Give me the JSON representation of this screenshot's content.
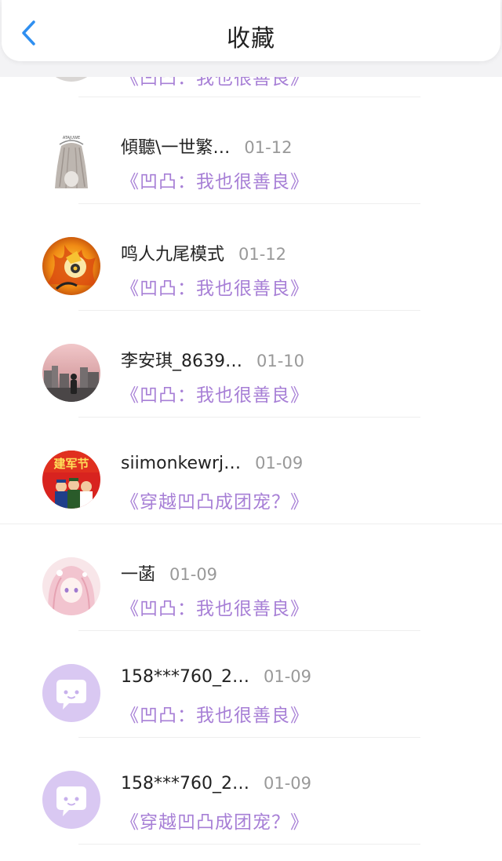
{
  "header": {
    "title": "收藏"
  },
  "partial_item": {
    "book": "《凹凸：我也很善良》"
  },
  "items": [
    {
      "name": "傾聽\\一世繁…",
      "date": "01-12",
      "book": "《凹凸：我也很善良》",
      "avatar": "portrait-sketch"
    },
    {
      "name": "鸣人九尾模式",
      "date": "01-12",
      "book": "《凹凸：我也很善良》",
      "avatar": "naruto-nine-tails"
    },
    {
      "name": "李安琪_8639…",
      "date": "01-10",
      "book": "《凹凸：我也很善良》",
      "avatar": "city-dusk"
    },
    {
      "name": "siimonkewrj…",
      "date": "01-09",
      "book": "《穿越凹凸成团宠？》",
      "avatar": "army-day",
      "avatar_text": "建军节"
    },
    {
      "name": "一菡",
      "date": "01-09",
      "book": "《凹凸：我也很善良》",
      "avatar": "anime-girl-pink"
    },
    {
      "name": "158***760_2…",
      "date": "01-09",
      "book": "《凹凸：我也很善良》",
      "avatar": "default-chat-avatar"
    },
    {
      "name": "158***760_2…",
      "date": "01-09",
      "book": "《穿越凹凸成团宠？》",
      "avatar": "default-chat-avatar"
    }
  ],
  "colors": {
    "accent_blue": "#2f8ff0",
    "book_title_purple": "#a77fd6",
    "default_avatar_bg": "#d9c8f2"
  }
}
